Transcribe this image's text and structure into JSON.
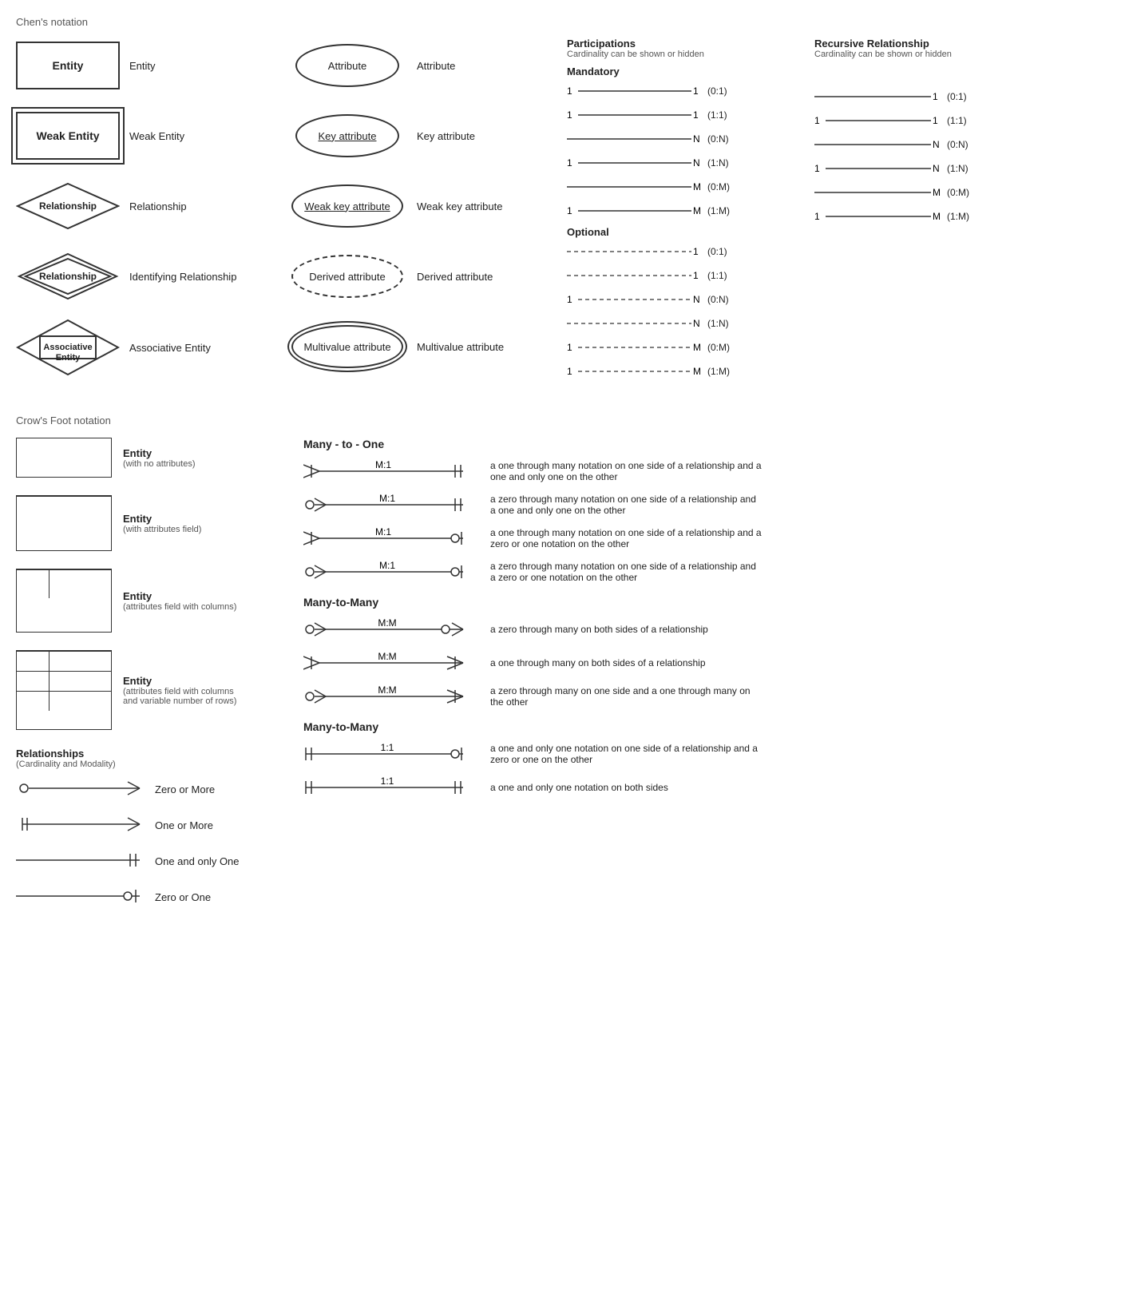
{
  "chens": {
    "header": "Chen's notation",
    "entities": [
      {
        "label": "Entity",
        "desc": "Entity"
      },
      {
        "label": "Weak Entity",
        "desc": "Weak Entity"
      },
      {
        "label": "Relationship",
        "desc": "Relationship"
      },
      {
        "label": "Relationship",
        "desc": "Identifying Relationship"
      },
      {
        "label": "Associative\nEntity",
        "desc": "Associative Entity"
      }
    ],
    "attributes": [
      {
        "label": "Attribute",
        "type": "normal",
        "desc": "Attribute"
      },
      {
        "label": "Key attribute",
        "type": "underline",
        "desc": "Key attribute"
      },
      {
        "label": "Weak key attribute",
        "type": "underline",
        "desc": "Weak key attribute"
      },
      {
        "label": "Derived attribute",
        "type": "dashed",
        "desc": "Derived attribute"
      },
      {
        "label": "Multivalue attribute",
        "type": "double",
        "desc": "Multivalue attribute"
      }
    ]
  },
  "participations": {
    "header": "Participations",
    "sub": "Cardinality can be shown or hidden",
    "mandatory_label": "Mandatory",
    "optional_label": "Optional",
    "mandatory_rows": [
      {
        "left": "1",
        "right": "1",
        "cardinality": "(0:1)"
      },
      {
        "left": "1",
        "right": "1",
        "cardinality": "(1:1)"
      },
      {
        "left": "",
        "right": "N",
        "cardinality": "(0:N)"
      },
      {
        "left": "1",
        "right": "N",
        "cardinality": "(1:N)"
      },
      {
        "left": "",
        "right": "M",
        "cardinality": "(0:M)"
      },
      {
        "left": "1",
        "right": "M",
        "cardinality": "(1:M)"
      }
    ],
    "optional_rows": [
      {
        "left": "",
        "right": "1",
        "cardinality": "(0:1)"
      },
      {
        "left": "",
        "right": "1",
        "cardinality": "(1:1)"
      },
      {
        "left": "1",
        "right": "N",
        "cardinality": "(0:N)"
      },
      {
        "left": "",
        "right": "N",
        "cardinality": "(1:N)"
      },
      {
        "left": "1",
        "right": "M",
        "cardinality": "(0:M)"
      },
      {
        "left": "1",
        "right": "M",
        "cardinality": "(1:M)"
      }
    ]
  },
  "recursive": {
    "header": "Recursive Relationship",
    "sub": "Cardinality can be shown or hidden",
    "rows": [
      {
        "left": "",
        "right": "1",
        "cardinality": "(0:1)"
      },
      {
        "left": "1",
        "right": "1",
        "cardinality": "(1:1)"
      },
      {
        "left": "",
        "right": "N",
        "cardinality": "(0:N)"
      },
      {
        "left": "1",
        "right": "N",
        "cardinality": "(1:N)"
      },
      {
        "left": "",
        "right": "M",
        "cardinality": "(0:M)"
      },
      {
        "left": "1",
        "right": "M",
        "cardinality": "(1:M)"
      }
    ]
  },
  "crows": {
    "header": "Crow's Foot notation",
    "entities": [
      {
        "desc1": "Entity",
        "desc2": "(with no attributes)",
        "type": "simple"
      },
      {
        "desc1": "Entity",
        "desc2": "(with attributes field)",
        "type": "attrs"
      },
      {
        "desc1": "Entity",
        "desc2": "(attributes field with columns)",
        "type": "cols"
      },
      {
        "desc1": "Entity",
        "desc2": "(attributes field with columns and variable number of rows)",
        "type": "variable"
      }
    ],
    "relationships_header": "Relationships",
    "relationships_sub": "(Cardinality and Modality)",
    "rel_types": [
      {
        "label": "Zero or More"
      },
      {
        "label": "One or More"
      },
      {
        "label": "One and only One"
      },
      {
        "label": "Zero or One"
      }
    ],
    "many_to_one_header": "Many - to - One",
    "many_to_one_rows": [
      {
        "label": "M:1",
        "desc": "a one through many notation on one side of a relationship and a one and only one on the other"
      },
      {
        "label": "M:1",
        "desc": "a zero through many notation on one side of a relationship and a one and only one on the other"
      },
      {
        "label": "M:1",
        "desc": "a one through many notation on one side of a relationship and a zero or one notation on the other"
      },
      {
        "label": "M:1",
        "desc": "a zero through many notation on one side of a relationship and a zero or one notation on the other"
      }
    ],
    "many_to_many_header": "Many-to-Many",
    "many_to_many_rows": [
      {
        "label": "M:M",
        "desc": "a zero through many on both sides of a relationship"
      },
      {
        "label": "M:M",
        "desc": "a one through many on both sides of a relationship"
      },
      {
        "label": "M:M",
        "desc": "a zero through many on one side and a one through many on the other"
      }
    ],
    "one_to_one_header": "Many-to-Many",
    "one_to_one_rows": [
      {
        "label": "1:1",
        "desc": "a one and only one notation on one side of a relationship and a zero or one on the other"
      },
      {
        "label": "1:1",
        "desc": "a one and only one notation on both sides"
      }
    ]
  }
}
